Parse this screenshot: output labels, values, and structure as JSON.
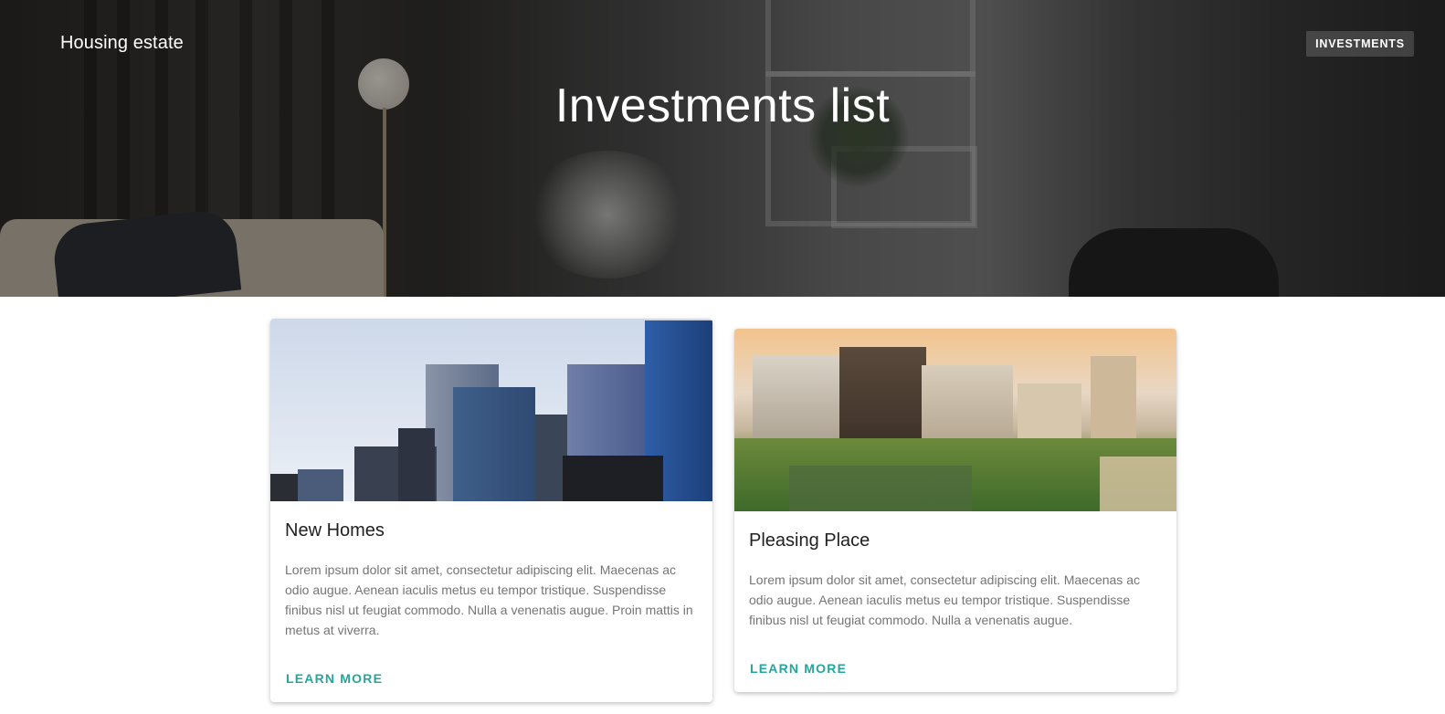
{
  "header": {
    "brand": "Housing estate",
    "nav": [
      {
        "label": "INVESTMENTS"
      }
    ],
    "title": "Investments list"
  },
  "cards": [
    {
      "title": "New Homes",
      "text": "Lorem ipsum dolor sit amet, consectetur adipiscing elit. Maecenas ac odio augue. Aenean iaculis metus eu tempor tristique. Suspendisse finibus nisl ut feugiat commodo. Nulla a venenatis augue. Proin mattis in metus at viverra.",
      "action": "LEARN MORE"
    },
    {
      "title": "Pleasing Place",
      "text": "Lorem ipsum dolor sit amet, consectetur adipiscing elit. Maecenas ac odio augue. Aenean iaculis metus eu tempor tristique. Suspendisse finibus nisl ut feugiat commodo. Nulla a venenatis augue.",
      "action": "LEARN MORE"
    }
  ],
  "colors": {
    "accent": "#26a69a",
    "title_text": "#212121",
    "body_text": "#757575"
  }
}
